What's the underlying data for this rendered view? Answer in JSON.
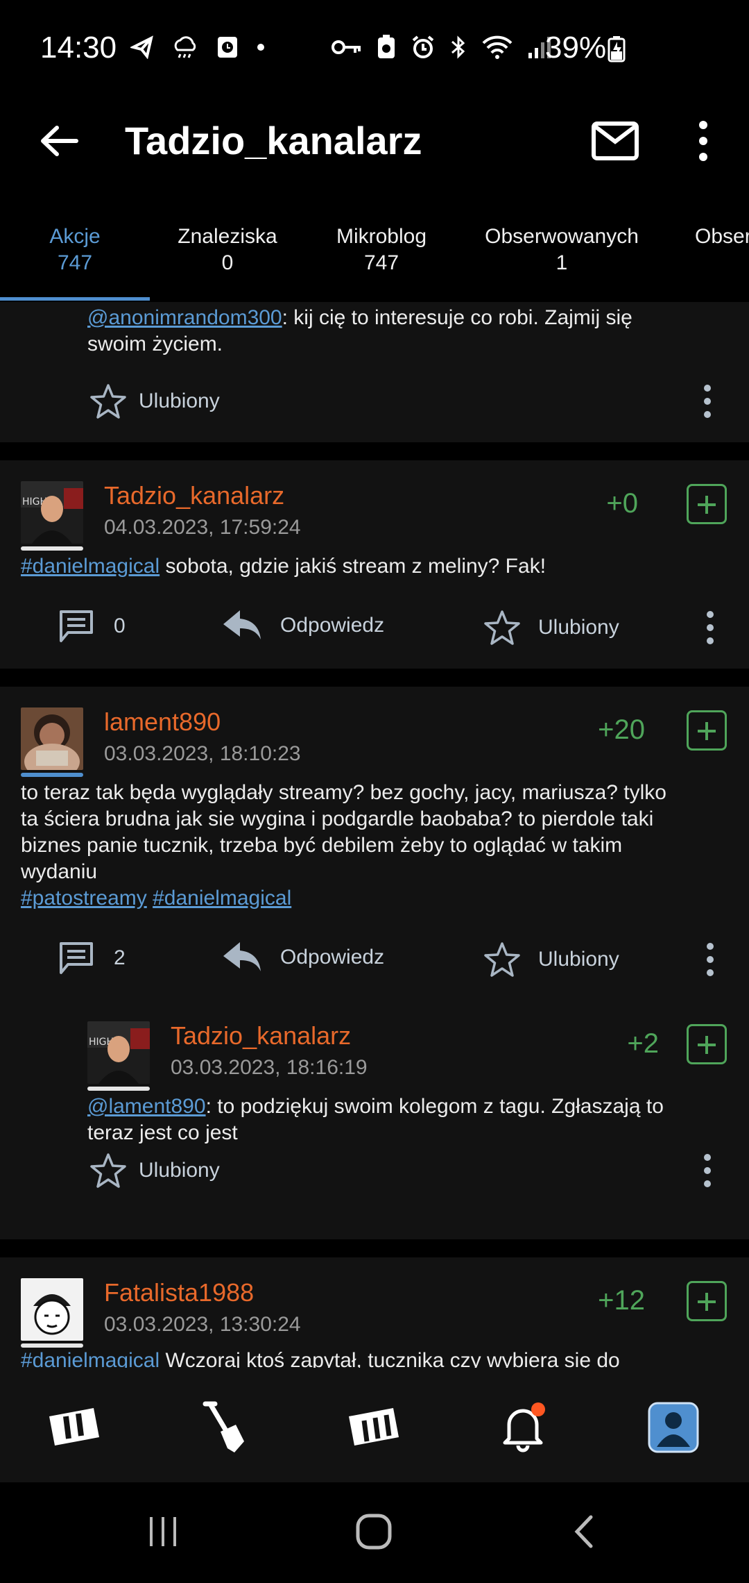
{
  "status_bar": {
    "time": "14:30",
    "battery": "39%"
  },
  "header": {
    "title": "Tadzio_kanalarz"
  },
  "tabs": [
    {
      "label": "Akcje",
      "count": "747"
    },
    {
      "label": "Znaleziska",
      "count": "0"
    },
    {
      "label": "Mikroblog",
      "count": "747"
    },
    {
      "label": "Obserwowanych",
      "count": "1"
    },
    {
      "label": "Obser",
      "count": ""
    }
  ],
  "comment_top": {
    "mention": "@anonimrandom300",
    "text": ": kij cię to interesuje co robi. Zajmij się",
    "text2": "swoim życiem.",
    "fav_label": "Ulubiony"
  },
  "post1": {
    "author": "Tadzio_kanalarz",
    "date": "04.03.2023, 17:59:24",
    "score": "+0",
    "tag": "#danielmagical",
    "text": " sobota, gdzie jakiś stream z meliny? Fak!",
    "comments": "0",
    "reply_label": "Odpowiedz",
    "fav_label": "Ulubiony"
  },
  "post2": {
    "author": "lament890",
    "date": "03.03.2023, 18:10:23",
    "score": "+20",
    "line1": "to teraz tak będa wyglądały streamy? bez gochy, jacy, mariusza? tylko",
    "line2": "ta ściera brudna jak sie wygina i podgardle baobaba? to pierdole taki",
    "line3": "biznes panie tucznik, trzeba być debilem żeby to oglądać w takim",
    "line4": "wydaniu",
    "tag1": "#patostreamy",
    "tag2": "#danielmagical",
    "comments": "2",
    "reply_label": "Odpowiedz",
    "fav_label": "Ulubiony"
  },
  "reply1": {
    "author": "Tadzio_kanalarz",
    "date": "03.03.2023, 18:16:19",
    "score": "+2",
    "mention": "@lament890",
    "text": ": to podziękuj swoim kolegom z tagu. Zgłaszają to",
    "text2": "teraz jest co jest",
    "fav_label": "Ulubiony"
  },
  "post3": {
    "author": "Fatalista1988",
    "date": "03.03.2023, 13:30:24",
    "score": "+12",
    "tag": "#danielmagical",
    "text": " Wczoraj ktoś zapytał, tucznika czy wybiera się do"
  },
  "bottom_nav": [
    "home-w-icon",
    "shovel-icon",
    "mikroblog-m-icon",
    "bell-icon",
    "profile-icon"
  ],
  "colors": {
    "accent": "#5b9bd5",
    "author": "#e8692b",
    "score": "#4fa55a",
    "notification": "#ff5722"
  }
}
